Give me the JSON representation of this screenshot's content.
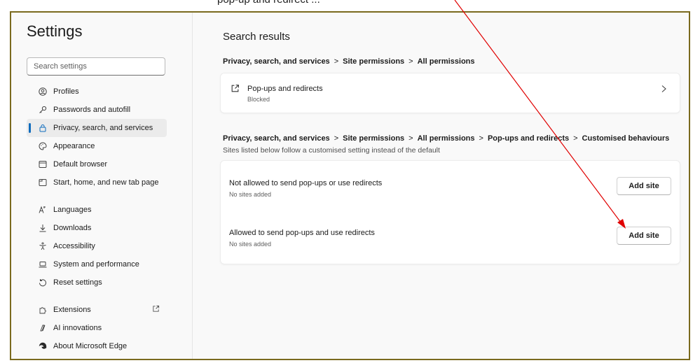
{
  "top_cutoff_text": "pop-up and redirect ...",
  "sidebar": {
    "title": "Settings",
    "search_placeholder": "Search settings",
    "items": [
      {
        "label": "Profiles",
        "icon": "profile-icon"
      },
      {
        "label": "Passwords and autofill",
        "icon": "key-icon"
      },
      {
        "label": "Privacy, search, and services",
        "icon": "lock-icon",
        "active": true
      },
      {
        "label": "Appearance",
        "icon": "palette-icon"
      },
      {
        "label": "Default browser",
        "icon": "browser-icon"
      },
      {
        "label": "Start, home, and new tab page",
        "icon": "home-tab-icon"
      },
      {
        "label": "Languages",
        "icon": "language-icon"
      },
      {
        "label": "Downloads",
        "icon": "download-icon"
      },
      {
        "label": "Accessibility",
        "icon": "accessibility-icon"
      },
      {
        "label": "System and performance",
        "icon": "laptop-icon"
      },
      {
        "label": "Reset settings",
        "icon": "reset-icon"
      },
      {
        "label": "Extensions",
        "icon": "puzzle-icon"
      },
      {
        "label": "AI innovations",
        "icon": "ai-icon"
      },
      {
        "label": "About Microsoft Edge",
        "icon": "edge-icon"
      }
    ]
  },
  "main": {
    "title": "Search results",
    "breadcrumb1": [
      "Privacy, search, and services",
      "Site permissions",
      "All permissions"
    ],
    "popups_row": {
      "title": "Pop-ups and redirects",
      "status": "Blocked"
    },
    "breadcrumb2": [
      "Privacy, search, and services",
      "Site permissions",
      "All permissions",
      "Pop-ups and redirects",
      "Customised behaviours"
    ],
    "breadcrumb2_desc": "Sites listed below follow a customised setting instead of the default",
    "rows": [
      {
        "title": "Not allowed to send pop-ups or use redirects",
        "sub": "No sites added",
        "button": "Add site"
      },
      {
        "title": "Allowed to send pop-ups and use redirects",
        "sub": "No sites added",
        "button": "Add site"
      }
    ]
  },
  "colors": {
    "accent": "#0f6cbd",
    "frame_border": "#7a6a1e",
    "annotation_arrow": "#e00000"
  }
}
